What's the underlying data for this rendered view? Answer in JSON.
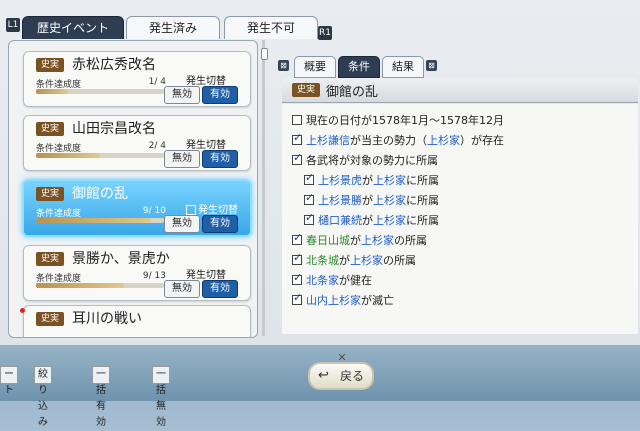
{
  "top_tabs": [
    {
      "label": "歴史イベント"
    },
    {
      "label": "発生済み"
    },
    {
      "label": "発生不可"
    }
  ],
  "shortcut_left": "L1",
  "shortcut_right": "R1",
  "events": [
    {
      "badge": "史実",
      "title": "赤松広秀改名",
      "progress_label": "条件達成度",
      "progress": "1/ 4",
      "progress_fraction": 0.25,
      "toggle_label": "発生切替",
      "btn_off": "無効",
      "btn_on": "有効"
    },
    {
      "badge": "史実",
      "title": "山田宗昌改名",
      "progress_label": "条件達成度",
      "progress": "2/ 4",
      "progress_fraction": 0.5,
      "toggle_label": "発生切替",
      "btn_off": "無効",
      "btn_on": "有効"
    },
    {
      "badge": "史実",
      "title": "御館の乱",
      "progress_label": "条件達成度",
      "progress": "9/ 10",
      "progress_fraction": 0.9,
      "toggle_label": "発生切替",
      "btn_off": "無効",
      "btn_on": "有効"
    },
    {
      "badge": "史実",
      "title": "景勝か、景虎か",
      "progress_label": "条件達成度",
      "progress": "9/ 13",
      "progress_fraction": 0.69,
      "toggle_label": "発生切替",
      "btn_off": "無効",
      "btn_on": "有効"
    },
    {
      "badge": "史実",
      "title": "耳川の戦い"
    }
  ],
  "detail_tabs": [
    {
      "label": "概要"
    },
    {
      "label": "条件"
    },
    {
      "label": "結果"
    }
  ],
  "detail": {
    "badge": "史実",
    "title": "御館の乱"
  },
  "conditions": [
    {
      "checked": false,
      "p1": "現在の日付が1578年1月～1578年12月"
    },
    {
      "checked": true,
      "h1": "上杉謙信",
      "p1": "が当主の勢力（",
      "h2": "上杉家",
      "p2": "）が存在"
    },
    {
      "checked": true,
      "p1": "各武将が対象の勢力に所属"
    },
    {
      "checked": true,
      "h1": "上杉景虎",
      "p1": "が",
      "h2": "上杉家",
      "p2": "に所属"
    },
    {
      "checked": true,
      "h1": "上杉景勝",
      "p1": "が",
      "h2": "上杉家",
      "p2": "に所属"
    },
    {
      "checked": true,
      "h1": "樋口兼続",
      "p1": "が",
      "h2": "上杉家",
      "p2": "に所属"
    },
    {
      "checked": true,
      "g1": "春日山城",
      "p1": "が",
      "h2": "上杉家",
      "p2": "の所属"
    },
    {
      "checked": true,
      "g1": "北条城",
      "p1": "が",
      "h2": "上杉家",
      "p2": "の所属"
    },
    {
      "checked": true,
      "h1": "北条家",
      "p1": "が健在"
    },
    {
      "checked": true,
      "h1": "山内上杉家",
      "p1": "が滅亡"
    }
  ],
  "bottom_buttons": [
    {
      "label": "ート"
    },
    {
      "label": "絞り込み"
    },
    {
      "label": "一括有効"
    },
    {
      "label": "一括無効"
    }
  ],
  "back_label": "戻る",
  "colors": {
    "selected": "#39a7e8",
    "tab_active": "#2f3d52",
    "badge": "#7b5222",
    "on_button": "#1f5fa8",
    "highlight_blue": "#1e5fc8",
    "highlight_green": "#2b8a2b"
  }
}
